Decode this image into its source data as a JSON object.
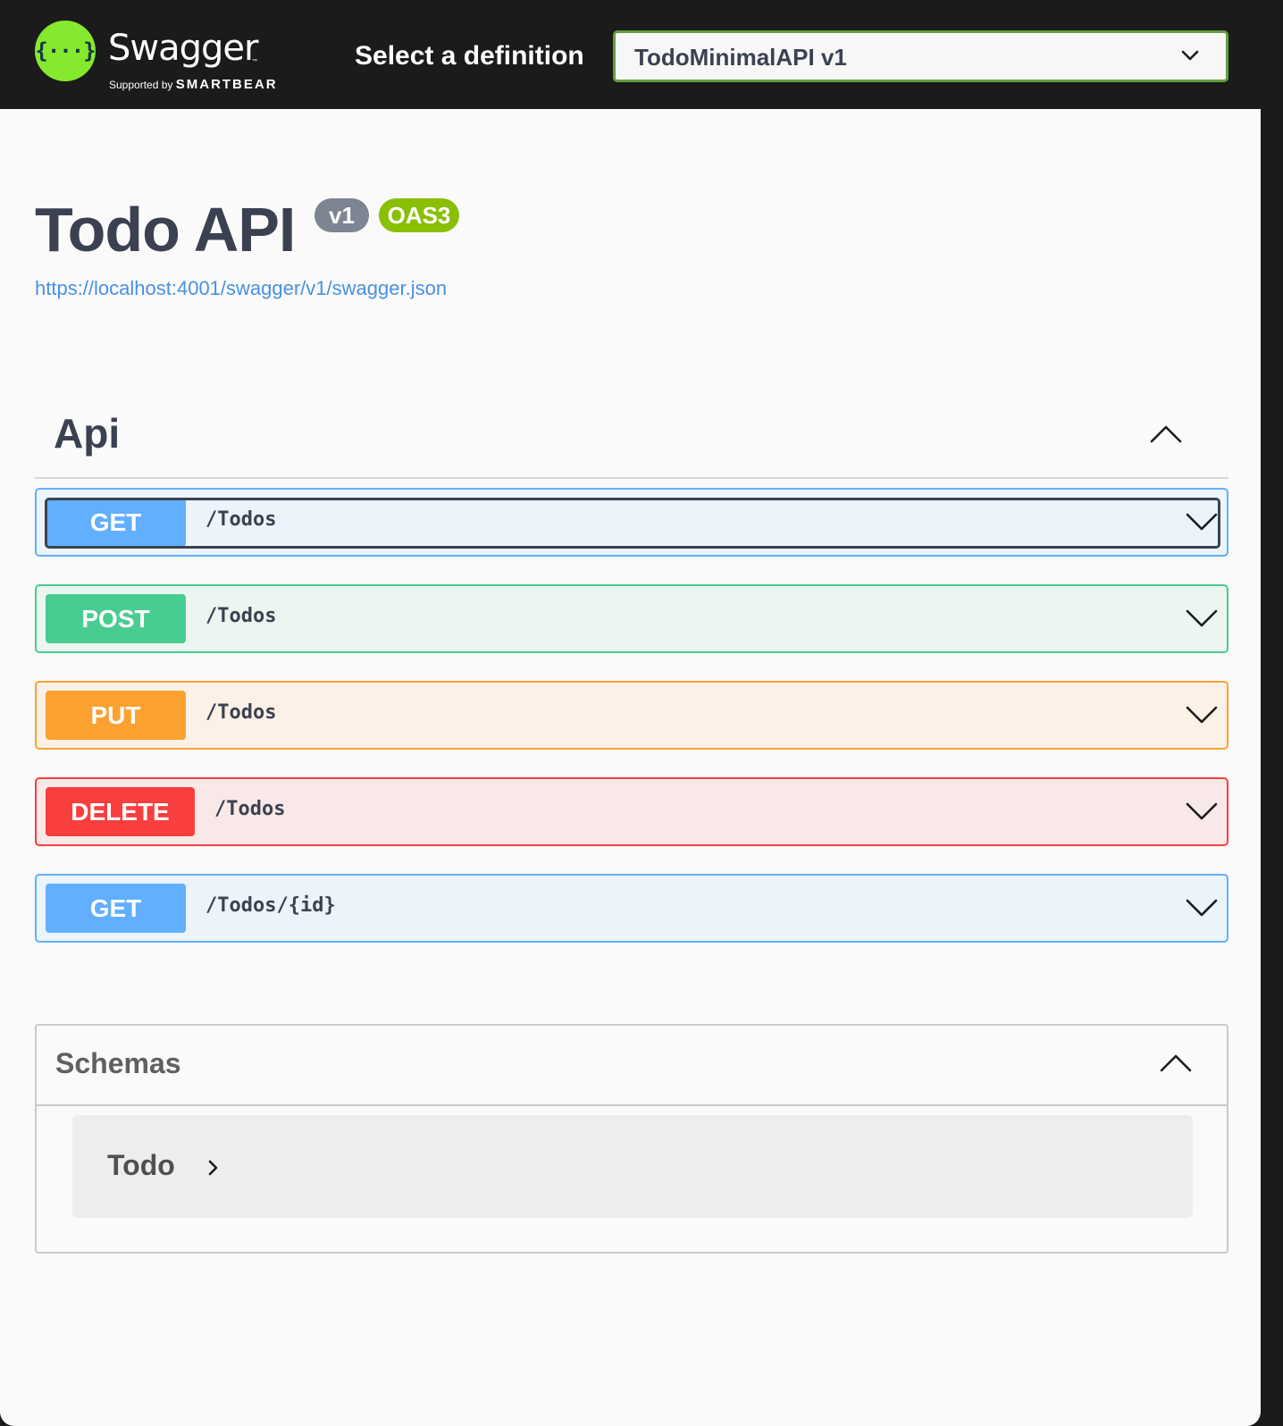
{
  "topbar": {
    "logo_symbol": "{···}",
    "logo_name": "Swagger",
    "logo_tm": "™",
    "supported_by": "Supported by",
    "supported_brand": "SMARTBEAR",
    "select_label": "Select a definition",
    "selected_definition": "TodoMinimalAPI v1"
  },
  "info": {
    "title": "Todo API",
    "version_badge": "v1",
    "oas_badge": "OAS3",
    "spec_url": "https://localhost:4001/swagger/v1/swagger.json"
  },
  "api_section": {
    "title": "Api",
    "operations": [
      {
        "method": "GET",
        "path": "/Todos"
      },
      {
        "method": "POST",
        "path": "/Todos"
      },
      {
        "method": "PUT",
        "path": "/Todos"
      },
      {
        "method": "DELETE",
        "path": "/Todos"
      },
      {
        "method": "GET",
        "path": "/Todos/{id}"
      }
    ]
  },
  "schemas": {
    "title": "Schemas",
    "models": [
      {
        "name": "Todo"
      }
    ]
  },
  "colors": {
    "topbar_bg": "#1b1b1b",
    "logo_green": "#85ea2d",
    "select_border": "#62a03f",
    "get": "#61affe",
    "post": "#49cc90",
    "put": "#fca130",
    "delete": "#f93e3e",
    "link": "#4990e2",
    "oas_badge": "#89bf04"
  },
  "icons": {
    "select_chevron": "chevron-down-icon",
    "section_toggle": "chevron-up-icon",
    "operation_toggle": "chevron-down-icon",
    "model_expand": "chevron-right-icon"
  }
}
